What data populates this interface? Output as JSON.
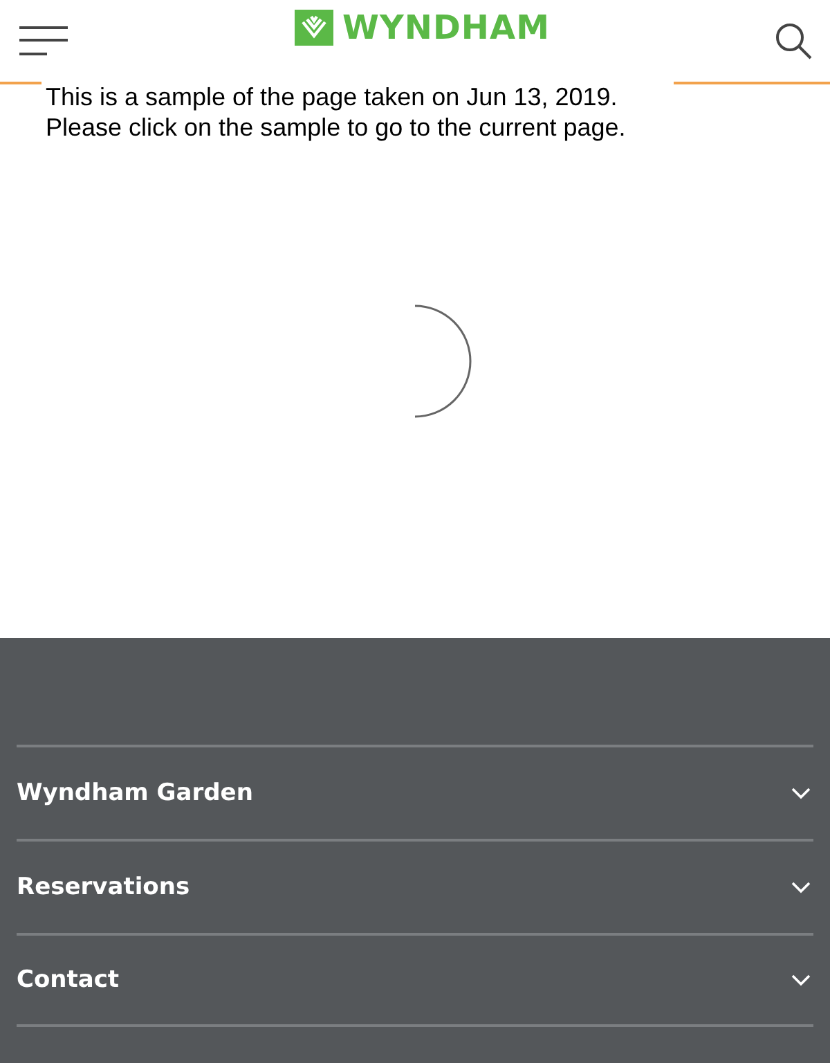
{
  "header": {
    "logo_text": "WYNDHAM"
  },
  "notice": {
    "lines": [
      "This is a sample of the page taken on Jun 13, 2019.",
      "Please click on the sample to go to the current page."
    ]
  },
  "footer": {
    "sections": [
      {
        "label": "Wyndham Garden",
        "expanded": false
      },
      {
        "label": "Reservations",
        "expanded": false
      },
      {
        "label": "Contact",
        "expanded": false
      }
    ]
  }
}
